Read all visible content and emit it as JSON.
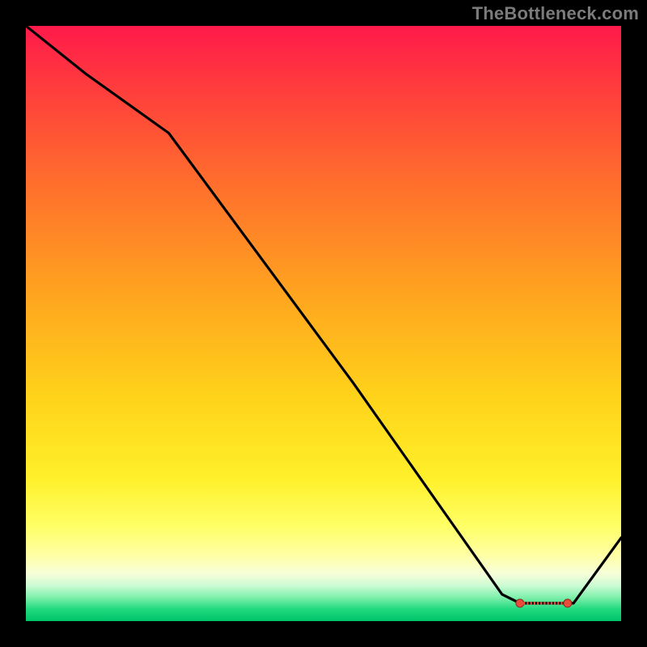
{
  "watermark": "TheBottleneck.com",
  "chart_data": {
    "type": "line",
    "title": "",
    "xlabel": "",
    "ylabel": "",
    "xlim": [
      0,
      100
    ],
    "ylim": [
      0,
      100
    ],
    "series": [
      {
        "name": "curve",
        "x": [
          0,
          10,
          24,
          55,
          80,
          83,
          86,
          89,
          92,
          100
        ],
        "y": [
          100,
          92,
          82,
          40,
          4.5,
          3,
          3,
          3,
          3,
          14
        ]
      }
    ],
    "markers": {
      "name": "near-min-band",
      "x": [
        83,
        85,
        87,
        89,
        91
      ],
      "y": [
        3,
        3,
        3,
        3,
        3
      ]
    },
    "gradient_stops": [
      {
        "pos": 0.0,
        "color": "#ff1a4b"
      },
      {
        "pos": 0.1,
        "color": "#ff3b3d"
      },
      {
        "pos": 0.25,
        "color": "#ff6a2e"
      },
      {
        "pos": 0.45,
        "color": "#ffa41f"
      },
      {
        "pos": 0.62,
        "color": "#ffd21a"
      },
      {
        "pos": 0.76,
        "color": "#fff02a"
      },
      {
        "pos": 0.84,
        "color": "#ffff66"
      },
      {
        "pos": 0.89,
        "color": "#ffffa6"
      },
      {
        "pos": 0.92,
        "color": "#f7ffd9"
      },
      {
        "pos": 0.94,
        "color": "#cdfbd3"
      },
      {
        "pos": 0.96,
        "color": "#7ef0ac"
      },
      {
        "pos": 0.98,
        "color": "#21d97e"
      },
      {
        "pos": 1.0,
        "color": "#00c46a"
      }
    ],
    "colors": {
      "curve": "#000000",
      "marker_fill": "#e74c3c",
      "marker_stroke": "#8b2a1f",
      "frame": "#000000"
    }
  }
}
